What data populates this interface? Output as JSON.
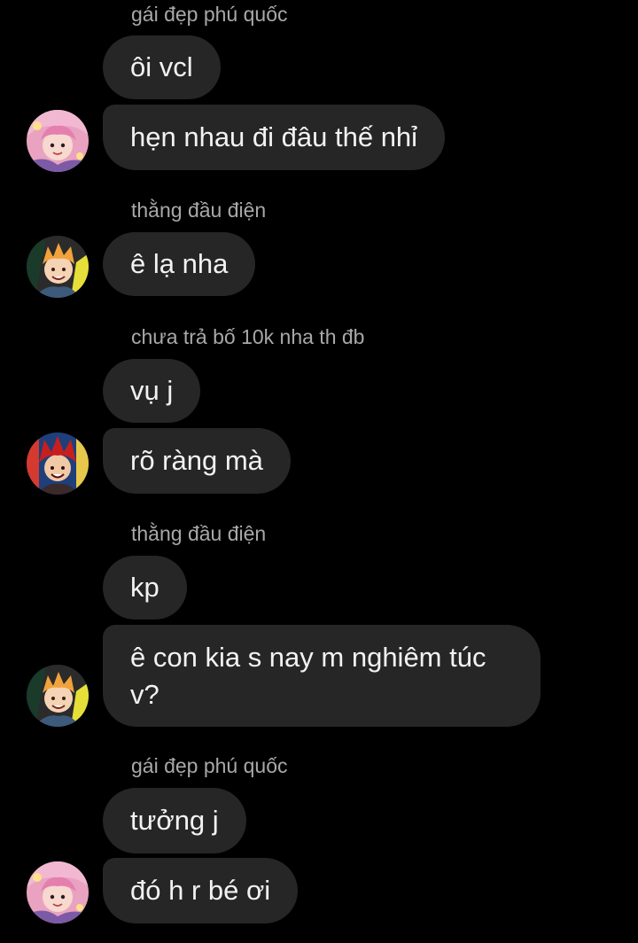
{
  "colors": {
    "background": "#000000",
    "bubble": "#262626",
    "bubble_text": "#f2f2f2",
    "sender_name": "#a8a8a8"
  },
  "groups": [
    {
      "sender": "gái đẹp phú quốc",
      "avatar_icon": "pink-hair-anime-avatar-icon",
      "messages": [
        "ôi vcl",
        "hẹn nhau đi đâu thế nhỉ"
      ]
    },
    {
      "sender": "thằng đầu điện",
      "avatar_icon": "blonde-anime-avatar-icon",
      "messages": [
        "ê lạ nha"
      ]
    },
    {
      "sender": "chưa trả bố 10k nha th đb",
      "avatar_icon": "red-hair-anime-avatar-icon",
      "messages": [
        "vụ j",
        "rõ ràng mà"
      ]
    },
    {
      "sender": "thằng đầu điện",
      "avatar_icon": "blonde-anime-avatar-icon",
      "messages": [
        "kp",
        "ê con kia s nay m nghiêm túc v?"
      ]
    },
    {
      "sender": "gái đẹp phú quốc",
      "avatar_icon": "pink-hair-anime-avatar-icon",
      "messages": [
        "tưởng j",
        "đó h r bé ơi"
      ]
    }
  ]
}
